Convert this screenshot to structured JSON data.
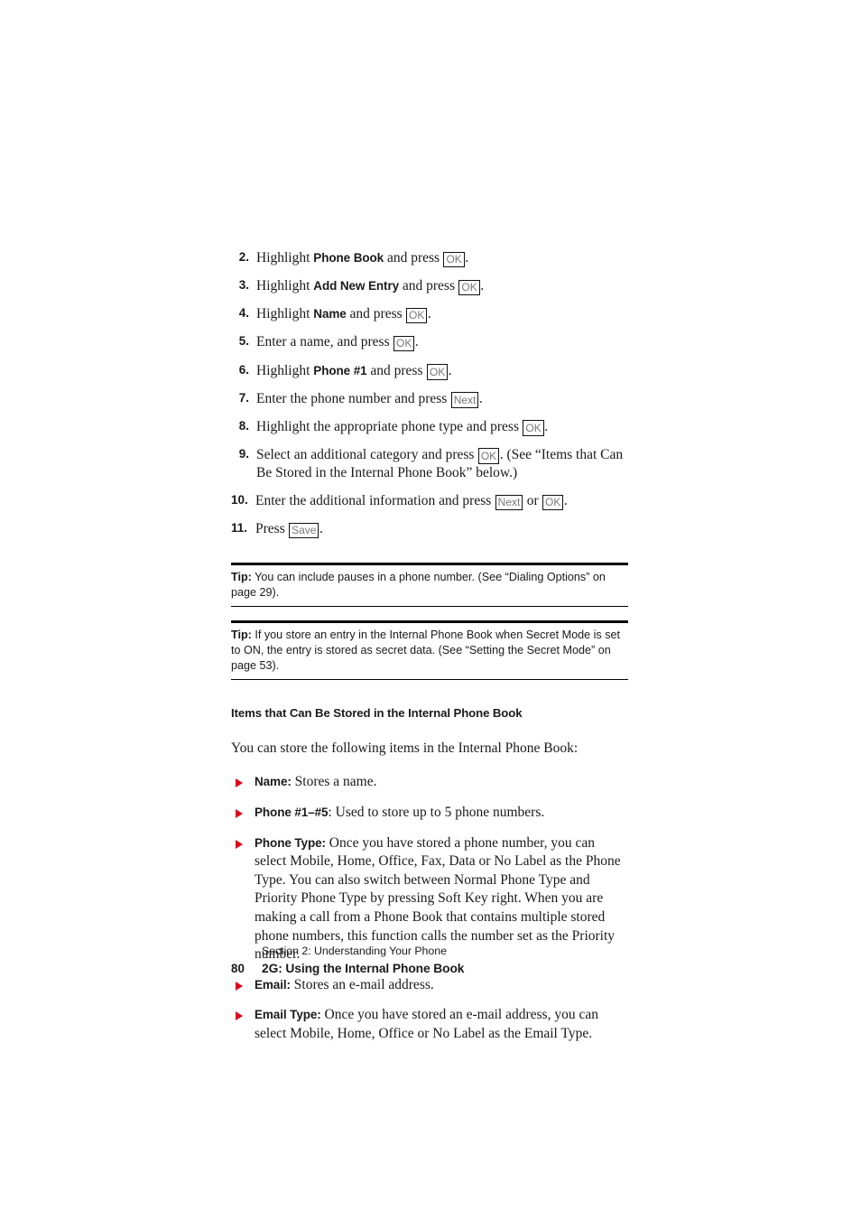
{
  "steps": [
    {
      "number": "2.",
      "parts": [
        {
          "t": "text",
          "v": "Highlight "
        },
        {
          "t": "ui",
          "v": "Phone Book"
        },
        {
          "t": "text",
          "v": " and press "
        },
        {
          "t": "key",
          "v": "OK"
        },
        {
          "t": "text",
          "v": "."
        }
      ]
    },
    {
      "number": "3.",
      "parts": [
        {
          "t": "text",
          "v": "Highlight "
        },
        {
          "t": "ui",
          "v": "Add New Entry"
        },
        {
          "t": "text",
          "v": " and press "
        },
        {
          "t": "key",
          "v": "OK"
        },
        {
          "t": "text",
          "v": "."
        }
      ]
    },
    {
      "number": "4.",
      "parts": [
        {
          "t": "text",
          "v": "Highlight "
        },
        {
          "t": "ui",
          "v": "Name"
        },
        {
          "t": "text",
          "v": " and press "
        },
        {
          "t": "key",
          "v": "OK"
        },
        {
          "t": "text",
          "v": "."
        }
      ]
    },
    {
      "number": "5.",
      "parts": [
        {
          "t": "text",
          "v": "Enter a name, and press "
        },
        {
          "t": "key",
          "v": "OK"
        },
        {
          "t": "text",
          "v": "."
        }
      ]
    },
    {
      "number": "6.",
      "parts": [
        {
          "t": "text",
          "v": "Highlight "
        },
        {
          "t": "ui",
          "v": "Phone #1"
        },
        {
          "t": "text",
          "v": " and press "
        },
        {
          "t": "key",
          "v": "OK"
        },
        {
          "t": "text",
          "v": "."
        }
      ]
    },
    {
      "number": "7.",
      "parts": [
        {
          "t": "text",
          "v": "Enter the phone number and press "
        },
        {
          "t": "key",
          "v": "Next"
        },
        {
          "t": "text",
          "v": "."
        }
      ]
    },
    {
      "number": "8.",
      "parts": [
        {
          "t": "text",
          "v": "Highlight the appropriate phone type and press "
        },
        {
          "t": "key",
          "v": "OK"
        },
        {
          "t": "text",
          "v": "."
        }
      ]
    },
    {
      "number": "9.",
      "parts": [
        {
          "t": "text",
          "v": "Select an additional category and press "
        },
        {
          "t": "key",
          "v": "OK"
        },
        {
          "t": "text",
          "v": ". (See “Items that Can Be Stored in the Internal Phone Book” below.)"
        }
      ]
    },
    {
      "number": "10.",
      "wide": true,
      "parts": [
        {
          "t": "text",
          "v": "Enter the additional information and press "
        },
        {
          "t": "key",
          "v": "Next"
        },
        {
          "t": "text",
          "v": " or "
        },
        {
          "t": "key",
          "v": "OK"
        },
        {
          "t": "text",
          "v": "."
        }
      ]
    },
    {
      "number": "11.",
      "wide": true,
      "parts": [
        {
          "t": "text",
          "v": "Press "
        },
        {
          "t": "key",
          "v": "Save"
        },
        {
          "t": "text",
          "v": "."
        }
      ]
    }
  ],
  "tips": [
    {
      "lead": "Tip:",
      "body": " You can include pauses in a phone number. (See “Dialing Options” on page 29)."
    },
    {
      "lead": "Tip:",
      "body": " If you store an entry in the Internal Phone Book when Secret Mode is set to ON, the entry is stored as secret data. (See “Setting the Secret Mode” on page 53)."
    }
  ],
  "subsection": {
    "heading": "Items that Can Be Stored in the Internal Phone Book",
    "intro": "You can store the following items in the Internal Phone Book:",
    "items": [
      {
        "label": "Name:",
        "body": " Stores a name."
      },
      {
        "label": "Phone #1–#5",
        "body": ": Used to store up to 5 phone numbers."
      },
      {
        "label": "Phone Type:",
        "body": " Once you have stored a phone number, you can select Mobile, Home, Office, Fax, Data or No Label as the Phone Type. You can also switch between Normal Phone Type and Priority Phone Type by pressing Soft Key right. When you are making a call from a Phone Book that contains multiple stored phone numbers, this function calls the number set as the Priority number."
      },
      {
        "label": "Email:",
        "body": " Stores an e-mail address."
      },
      {
        "label": "Email Type:",
        "body": " Once you have stored an e-mail address, you can select Mobile, Home, Office or No Label as the Email Type."
      }
    ]
  },
  "footer": {
    "section": "Section 2: Understanding Your Phone",
    "page_number": "80",
    "chapter_title": "2G: Using the Internal Phone Book"
  },
  "colors": {
    "bullet": "#e2001a",
    "text": "#1a1a1a",
    "key_label": "#777777",
    "rule": "#000000"
  }
}
